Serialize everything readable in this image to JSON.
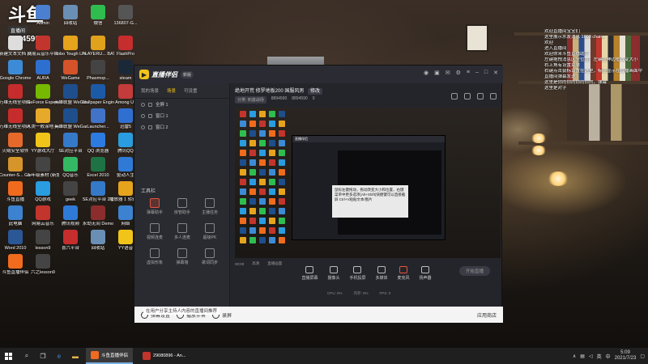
{
  "overlay": {
    "logo_text": "斗鱼",
    "tag": "直播间",
    "room_number": "8894590"
  },
  "desktop_icons": [
    {
      "label": "Admin",
      "color": "#4b7fd0"
    },
    {
      "label": "回收站",
      "color": "#6a8fb5"
    },
    {
      "label": "微信",
      "color": "#2fbd50"
    },
    {
      "label": "136807-G...",
      "color": "#555"
    },
    {
      "label": "新建文本文档 (2)",
      "color": "#ddd"
    },
    {
      "label": "网易云音乐平台",
      "color": "#c2352d"
    },
    {
      "label": "Robo Tough Life",
      "color": "#e6a31c"
    },
    {
      "label": "PLAYERU... BATTLEGR...",
      "color": "#e0a11b"
    },
    {
      "label": "FlashPro",
      "color": "#c62d2d"
    },
    {
      "label": "Google Chrome",
      "color": "#3d8bd6"
    },
    {
      "label": "AURA",
      "color": "#2d6fcf"
    },
    {
      "label": "WeGame",
      "color": "#d4532b"
    },
    {
      "label": "Phasmop...",
      "color": "#444"
    },
    {
      "label": "steam",
      "color": "#1b2838"
    },
    {
      "label": "万维无线全项网...",
      "color": "#c72c2c"
    },
    {
      "label": "GeForce Experience",
      "color": "#76b900"
    },
    {
      "label": "英雄联盟 WeGame版",
      "color": "#1e4e8c"
    },
    {
      "label": "Wallpaper Engine",
      "color": "#1c5aa8"
    },
    {
      "label": "Among Us",
      "color": "#c43b3b"
    },
    {
      "label": "万维无线全项网...",
      "color": "#c72c2c"
    },
    {
      "label": "人类一败涂地 Human: Fa...",
      "color": "#e6a92a"
    },
    {
      "label": "英雄联盟 WeGame版",
      "color": "#1e4e8c"
    },
    {
      "label": "Launcher...",
      "color": "#4173c9"
    },
    {
      "label": "迅雷5",
      "color": "#2f6fd1"
    },
    {
      "label": "火绒安全软件",
      "color": "#e5692b"
    },
    {
      "label": "YY游戏大厅",
      "color": "#f0c419"
    },
    {
      "label": "SE对应平台",
      "color": "#3579c9"
    },
    {
      "label": "QQ 浏览器",
      "color": "#2d7be0"
    },
    {
      "label": "腾讯QQ",
      "color": "#2a9ce0"
    },
    {
      "label": "Counter-S... Global Off...",
      "color": "#d6952a"
    },
    {
      "label": "五年级素材 (新加坡)...",
      "color": "#444"
    },
    {
      "label": "QQ音乐",
      "color": "#33b864"
    },
    {
      "label": "Excel 2010",
      "color": "#1f7244"
    },
    {
      "label": "驱动人生",
      "color": "#2f7ad6"
    },
    {
      "label": "斗鱼直播",
      "color": "#f06b1d"
    },
    {
      "label": "QQ游戏",
      "color": "#2a9ce0"
    },
    {
      "label": "geek",
      "color": "#444"
    },
    {
      "label": "SE对应平台 2.0",
      "color": "#3579c9"
    },
    {
      "label": "播放器 1 转输 每日 1 课程...",
      "color": "#e6a31c"
    },
    {
      "label": "此电脑",
      "color": "#3d82d0"
    },
    {
      "label": "网易云音乐",
      "color": "#c2352d"
    },
    {
      "label": "腾讯视频",
      "color": "#2f7ad6"
    },
    {
      "label": "永劫无间 Demo",
      "color": "#8b2d2d"
    },
    {
      "label": "网络",
      "color": "#3d82d0"
    },
    {
      "label": "Word 2010",
      "color": "#2b5797"
    },
    {
      "label": "lesson9",
      "color": "#444"
    },
    {
      "label": "喜六平台",
      "color": "#c62d2d"
    },
    {
      "label": "回收站",
      "color": "#6a8fb5"
    },
    {
      "label": "YY语音",
      "color": "#f0c419"
    },
    {
      "label": "斗鱼直播伴侣",
      "color": "#f06b1d"
    },
    {
      "label": "六之lesson9",
      "color": "#444"
    }
  ],
  "chat": [
    "欢迎直播间宝宝们",
    "这里展示水友消息 1000 chairs",
    "欢迎",
    "进入直播间",
    "欢迎你来斗鱼直播助手",
    "左键拖拽消息区全位置，左键拉伸边框改变大小",
    "右上角有设置菜单",
    "右键点击鼠标设置在这里，标注显示在直播画面中",
    "直播间弹幕发送",
    "这里是你的你的你的你的，弹幕",
    "这里是对字"
  ],
  "app": {
    "name": "直播伴侣",
    "version": "新版",
    "tabs": [
      "我的场景",
      "场景",
      "可设置"
    ],
    "scenes": [
      "全屏 1",
      "窗口 1",
      "窗口 2"
    ],
    "tools_title": "工具栏",
    "tools": [
      {
        "label": "弹幕助手",
        "hot": true
      },
      {
        "label": "房管助手",
        "hot": false
      },
      {
        "label": "主播任务",
        "hot": false
      },
      {
        "label": "视频连麦",
        "hot": false
      },
      {
        "label": "多人连麦",
        "hot": false
      },
      {
        "label": "超级PK",
        "hot": false
      },
      {
        "label": "虚拟形象",
        "hot": false
      },
      {
        "label": "弹幕墙",
        "hot": false
      },
      {
        "label": "歌词同步",
        "hot": false
      }
    ],
    "stream_title": "绝地开荒 修罗地板200 国服风男",
    "stream_tag": "修改",
    "stream_meta": [
      "分类: 刺激战场",
      "8894590",
      "8894590",
      "0"
    ],
    "preview_window_title": "直播伴侣",
    "tooltip": "鼠标左键拖动，拖动改变大小和位置，右键菜单中更多选项(Alt+Shift)快捷键可以直接截屏 Ctrl+V粘贴文本/图片",
    "timeline": [
      "00:00",
      "高清",
      "直播画面"
    ],
    "bottom_actions": [
      {
        "label": "直播屏幕"
      },
      {
        "label": "摄像头"
      },
      {
        "label": "手机投屏"
      },
      {
        "label": "多媒体"
      },
      {
        "label": "麦克风",
        "red": true
      },
      {
        "label": "扬声器"
      }
    ],
    "start_button": "开始直播",
    "status": [
      "CPU: 0%",
      "内存: 0%",
      "FPS: 0"
    ],
    "footer": {
      "hint": "在用户分享主持人内容的直播间推荐",
      "items": [
        "弹幕设置",
        "播放伴奏",
        "录屏"
      ],
      "right": "应用商店"
    }
  },
  "taskbar": {
    "apps": [
      {
        "label": "斗鱼直播伴侣",
        "active": true,
        "color": "#f06b1d"
      },
      {
        "label": "29080896 - An...",
        "active": false,
        "color": "#c2352d"
      }
    ],
    "tray": [
      "∧",
      "英",
      "中"
    ],
    "time": "5:09",
    "date": "2021/7/23"
  }
}
